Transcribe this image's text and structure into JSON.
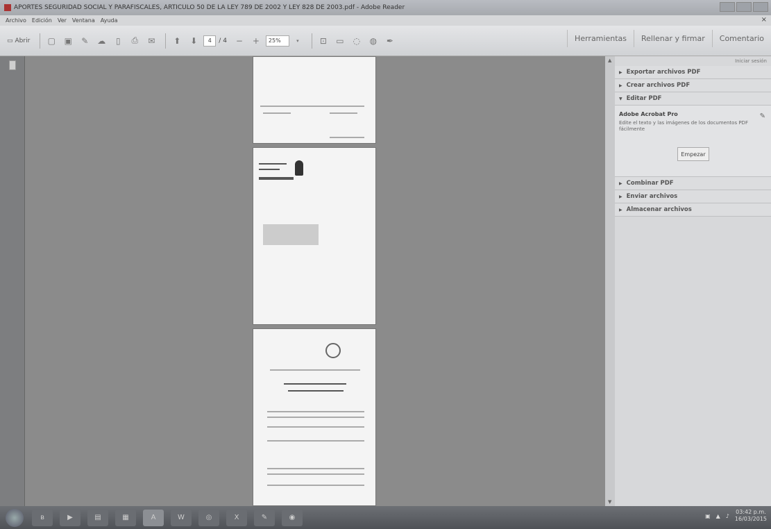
{
  "window": {
    "title": "APORTES SEGURIDAD SOCIAL Y PARAFISCALES, ARTICULO 50 DE LA LEY 789 DE 2002 Y LEY 828 DE 2003.pdf - Adobe Reader"
  },
  "menu": [
    "Archivo",
    "Edición",
    "Ver",
    "Ventana",
    "Ayuda"
  ],
  "toolbar": {
    "open_label": "Abrir",
    "page_current": "4",
    "page_total": "/ 4",
    "zoom": "25%",
    "right_tabs": [
      "Herramientas",
      "Rellenar y firmar",
      "Comentario"
    ]
  },
  "rightpane": {
    "top_link": "Iniciar sesión",
    "sections": {
      "export": "Exportar archivos PDF",
      "create": "Crear archivos PDF",
      "edit": "Editar PDF",
      "combine": "Combinar PDF",
      "send": "Enviar archivos",
      "store": "Almacenar archivos"
    },
    "edit_panel": {
      "product": "Adobe Acrobat Pro",
      "description": "Edite el texto y las imágenes de los documentos PDF fácilmente",
      "button": "Empezar"
    }
  },
  "taskbar": {
    "time": "03:42 p.m.",
    "date": "16/03/2015"
  }
}
